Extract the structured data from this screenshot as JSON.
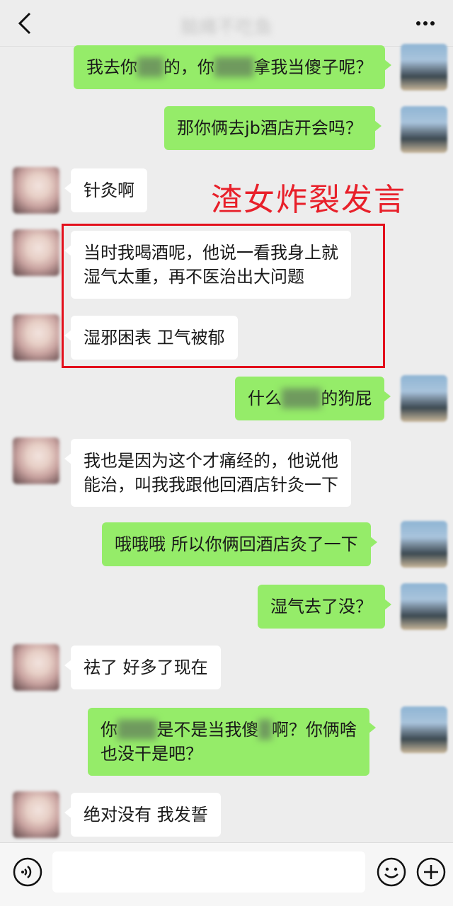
{
  "header": {
    "title": "脑瘫不吃鱼"
  },
  "annotation": "渣女炸裂发言",
  "messages": [
    {
      "side": "self",
      "parts": [
        "我去你",
        "██",
        "的，你",
        "███",
        "拿我当傻子呢？"
      ]
    },
    {
      "side": "self",
      "text": "那你俩去jb酒店开会吗？"
    },
    {
      "side": "other",
      "text": "针灸啊"
    },
    {
      "side": "other",
      "lines": [
        "当时我喝酒呢，他说一看我身上就",
        "湿气太重，再不医治出大问题"
      ]
    },
    {
      "side": "other",
      "text": "湿邪困表 卫气被郁"
    },
    {
      "side": "self",
      "parts": [
        "什么",
        "███",
        "的狗屁"
      ]
    },
    {
      "side": "other",
      "lines": [
        "我也是因为这个才痛经的，他说他",
        "能治，叫我我跟他回酒店针灸一下"
      ]
    },
    {
      "side": "self",
      "text": "哦哦哦 所以你俩回酒店灸了一下"
    },
    {
      "side": "self",
      "text": "湿气去了没？"
    },
    {
      "side": "other",
      "text": "祛了 好多了现在"
    },
    {
      "side": "self",
      "line1": [
        "你",
        "███",
        "是不是当我傻",
        "█",
        "啊？你俩啥"
      ],
      "line2": "也没干是吧？"
    },
    {
      "side": "other",
      "text": "绝对没有 我发誓"
    }
  ],
  "input": {
    "placeholder": ""
  },
  "icons": {
    "back": "chevron-left-icon",
    "more": "more-dots-icon",
    "voice": "voice-icon",
    "emoji": "emoji-icon",
    "plus": "plus-icon"
  },
  "colors": {
    "self_bubble": "#95ec69",
    "other_bubble": "#ffffff",
    "annotation": "#e8202a",
    "background": "#ededed"
  }
}
